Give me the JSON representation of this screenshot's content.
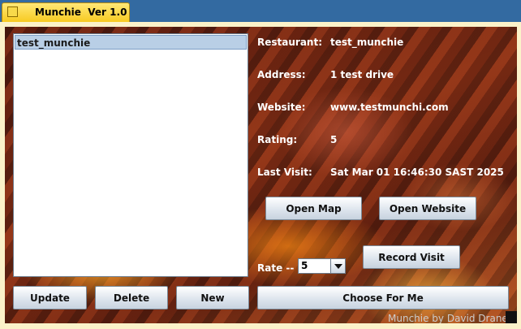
{
  "window": {
    "title": "Munchie  Ver 1.0",
    "icon": "app-icon"
  },
  "restaurant_list": {
    "items": [
      "test_munchie"
    ],
    "selected_index": 0
  },
  "details": {
    "fields": [
      {
        "label": "Restaurant:",
        "value": "test_munchie"
      },
      {
        "label": "Address:",
        "value": "1 test drive"
      },
      {
        "label": "Website:",
        "value": "www.testmunchi.com"
      },
      {
        "label": "Rating:",
        "value": "5"
      },
      {
        "label": "Last Visit:",
        "value": "Sat Mar 01 16:46:30 SAST 2025"
      }
    ]
  },
  "buttons": {
    "open_map": "Open Map",
    "open_website": "Open Website",
    "record_visit": "Record Visit",
    "update": "Update",
    "delete": "Delete",
    "new": "New",
    "choose_for_me": "Choose For Me"
  },
  "rate": {
    "label": "Rate --",
    "selected": "5"
  },
  "footer": {
    "credit": "Munchie by David Drane"
  },
  "colors": {
    "title_tab": "#f7c91d",
    "selection": "#b9cfe6",
    "label_text": "#ffffff"
  }
}
